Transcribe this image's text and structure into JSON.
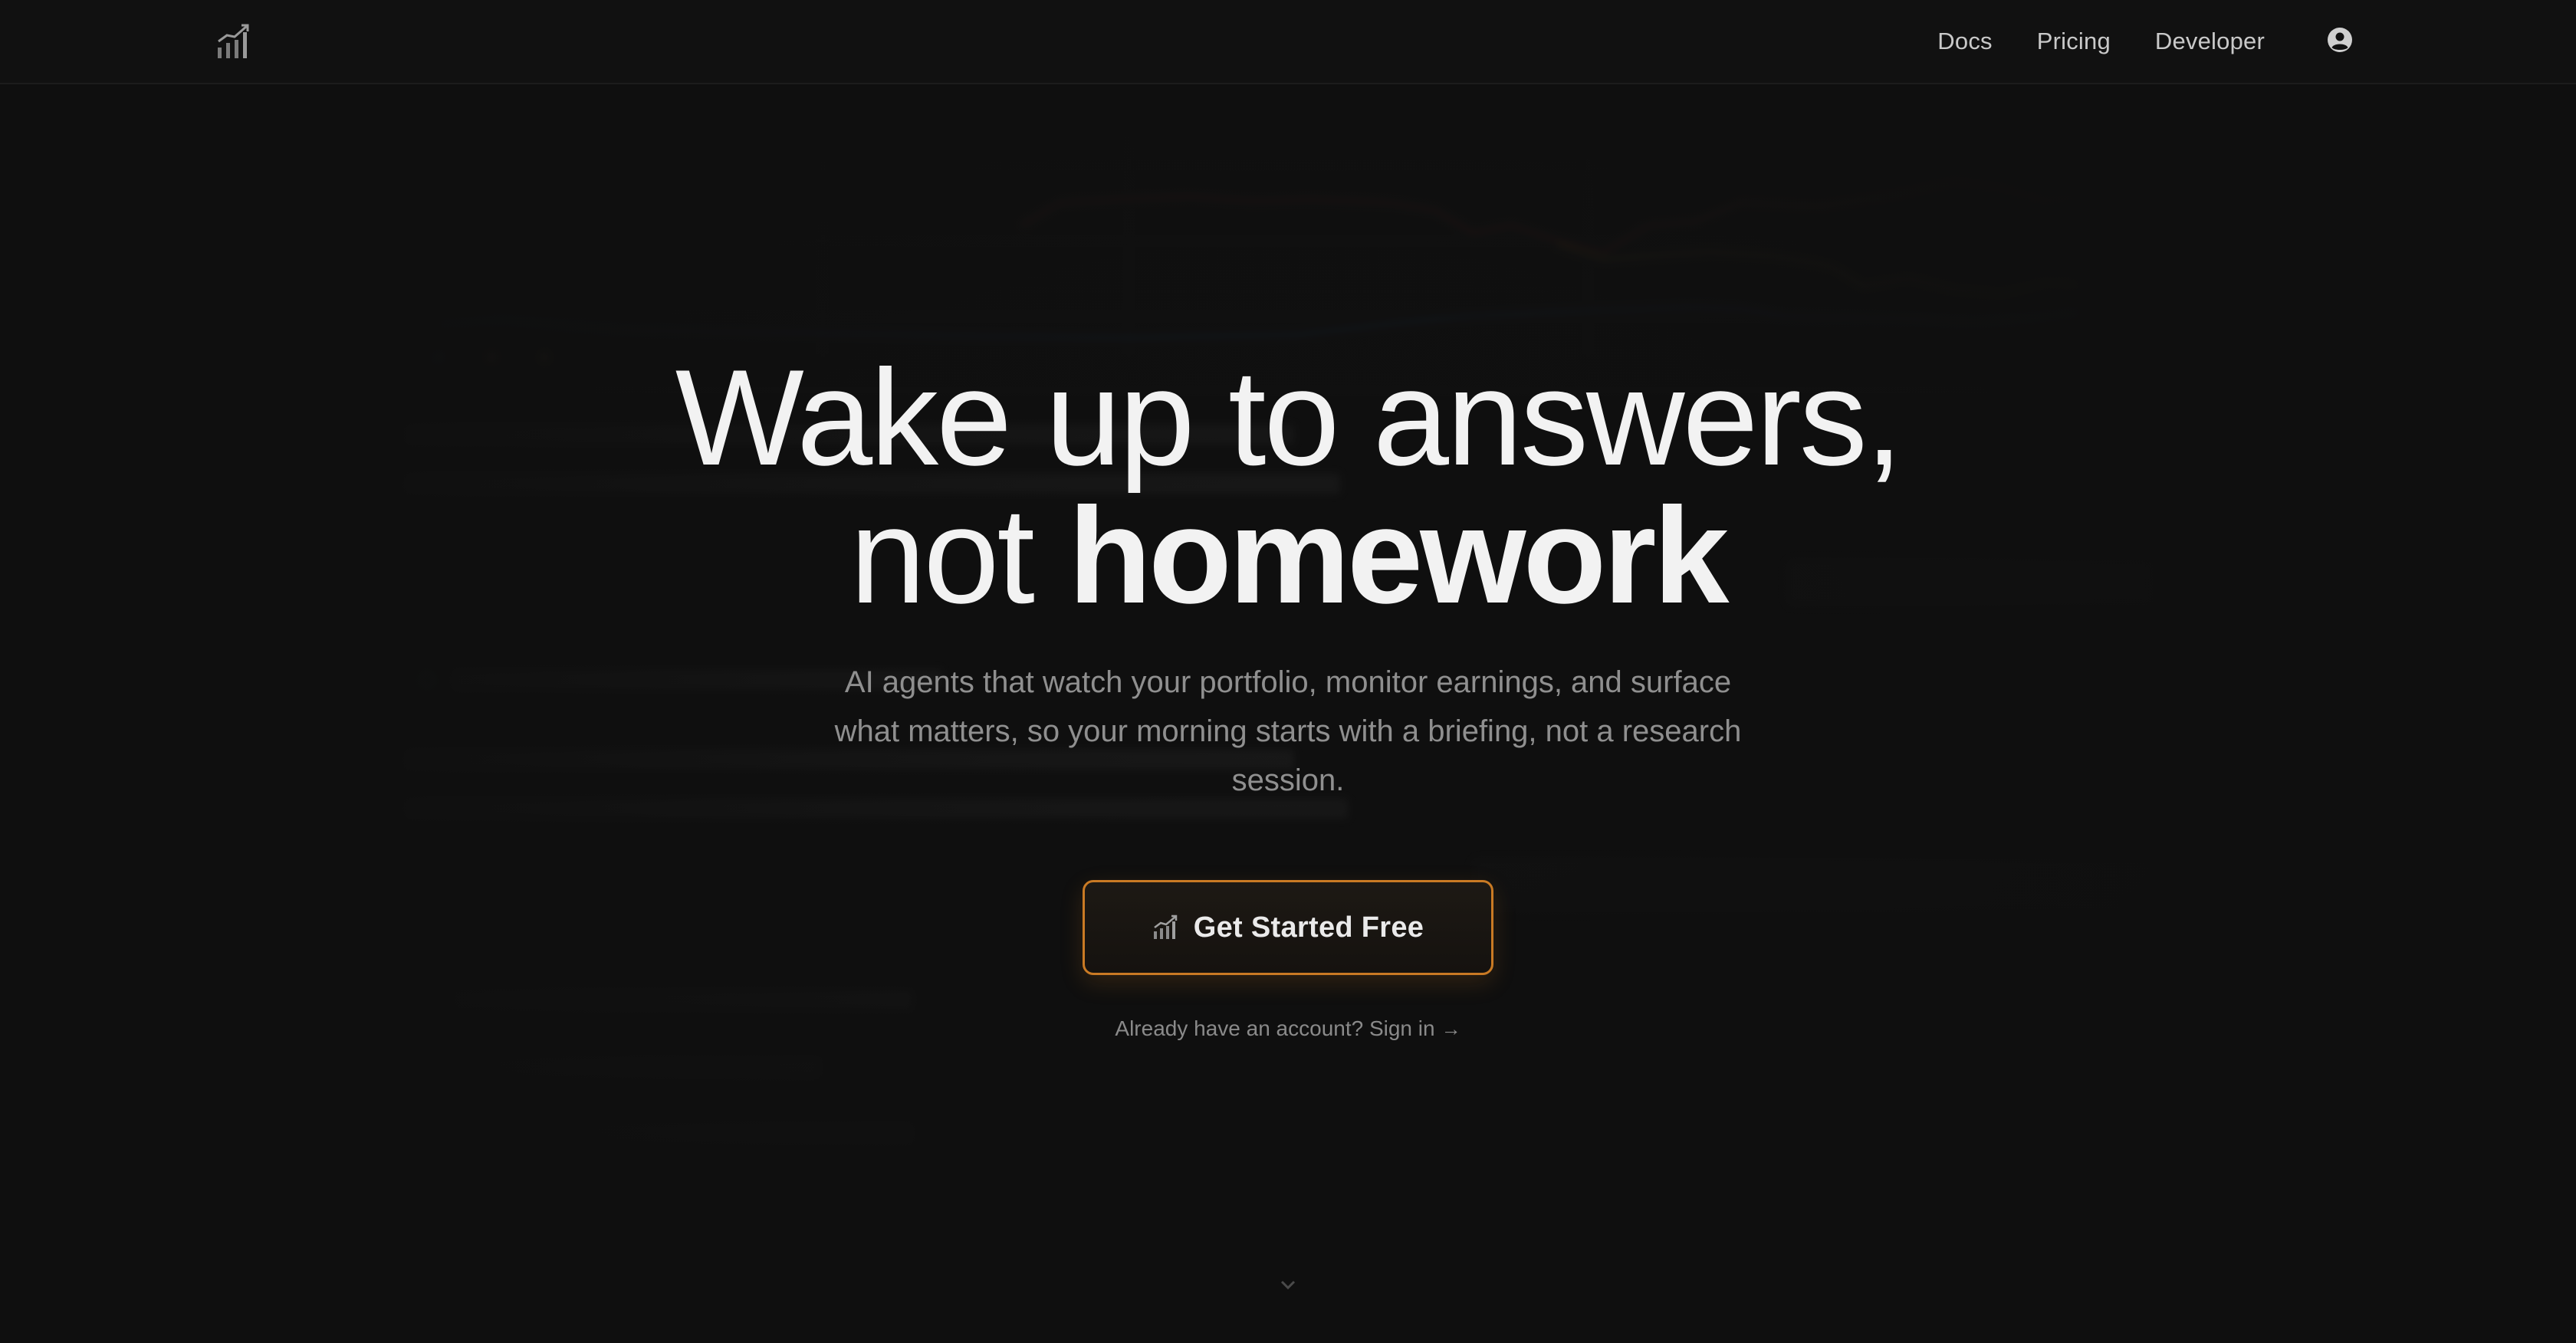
{
  "nav": {
    "links": [
      "Docs",
      "Pricing",
      "Developer"
    ],
    "logo_icon": "bar-chart-logo-icon",
    "account_icon": "user-circle-icon"
  },
  "hero": {
    "headline_line1": "Wake up to answers,",
    "headline_line2_light": "not ",
    "headline_line2_bold": "homework",
    "subcopy": "AI agents that watch your portfolio, monitor earnings, and surface what matters, so your morning starts with a briefing, not a research session.",
    "cta_label": "Get Started Free",
    "cta_icon": "bar-chart-icon",
    "signin_text": "Already have an account? Sign in",
    "signin_arrow": "→",
    "scroll_icon": "chevron-down-icon"
  },
  "colors": {
    "background": "#0f0f0f",
    "accent": "#c97a24",
    "text_primary": "#f2f2f2",
    "text_muted": "#8f8f8f"
  }
}
